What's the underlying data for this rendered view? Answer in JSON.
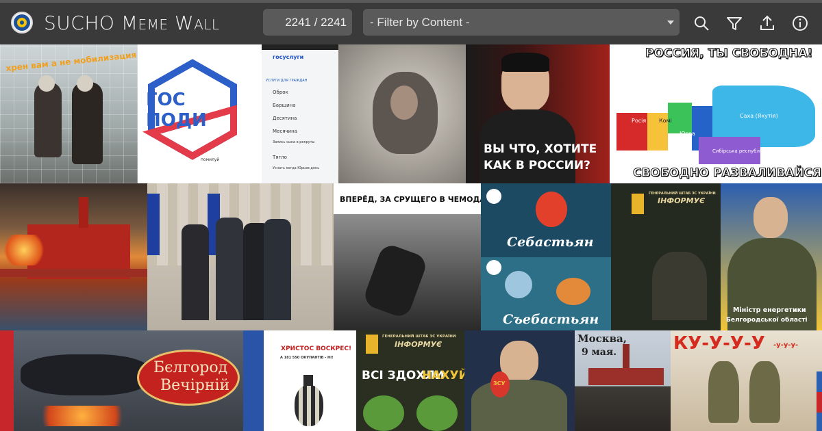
{
  "app": {
    "title_prefix": "SUCHO ",
    "title_meme": "Meme",
    "title_space": " ",
    "title_wall": "Wall",
    "counter": "2241 / 2241",
    "filter_placeholder": "- Filter by Content -"
  },
  "toolbar": {
    "icons": [
      "search-icon",
      "filter-icon",
      "upload-icon",
      "info-icon"
    ]
  },
  "memes": {
    "m1": "хрен вам а не мобилизация",
    "m2_line1": "ГОС",
    "m2_line2": "ПОДИ",
    "m2_small": "помилуй",
    "m3_brand": "госуслуги",
    "m3_section": "УСЛУГИ ДЛЯ ГРАЖДАН",
    "m3_items": [
      "Оброк",
      "Барщина",
      "Десятина",
      "Месячина",
      "Запись сына в рекруты",
      "Тягло",
      "Узнать когда Юрьев день"
    ],
    "m5_line1": "ВЫ ЧТО, ХОТИТЕ",
    "m5_line2": "КАК В РОССИИ?",
    "m6_top": "РОССИЯ, ТЫ СВОБОДНА!",
    "m6_bottom": "СВОБОДНО РАЗВАЛИВАЙСЯ!",
    "m6_regions": [
      "Саха (Якутія)",
      "Росія",
      "Комі",
      "Югра",
      "Сибірська республіка"
    ],
    "m9_caption": "ВПЕРЁД, ЗА СРУЩЕГО В ЧЕМОДАН!",
    "m10_top": "Себастьян",
    "m10_bottom": "Съебастьян",
    "m11_line1": "ГЕНЕРАЛЬНИЙ ШТАБ ЗС УКРАЇНИ",
    "m11_line2": "ІНФОРМУЄ",
    "m12_line1": "Міністр енергетики",
    "m12_line2": "Белгородської області",
    "m14_line1": "Бєлгород",
    "m14_line2": "Вечірній",
    "m15_line1": "ХРИСТОС ВОСКРЕС!",
    "m15_line2": "А 181 550 ОКУПАНТІВ - НІ!",
    "m16_line1": "ГЕНЕРАЛЬНИЙ ШТАБ ЗС УКРАЇНИ",
    "m16_line2": "ІНФОРМУЄ",
    "m16_line3": "ВСІ ЗДОХЛИ",
    "m16_line4": "НАХУЙ",
    "m17_egg": "ЗСУ",
    "m18_line1": "Москва,",
    "m18_line2": "9 мая.",
    "m19_line1": "КУ-У-У-У",
    "m19_line2": "-у-у-у-"
  },
  "colors": {
    "topbar": "#3a3a3a",
    "field": "#5a5a5a",
    "accent_red": "#d52b1e",
    "accent_blue": "#1c4fa1"
  }
}
